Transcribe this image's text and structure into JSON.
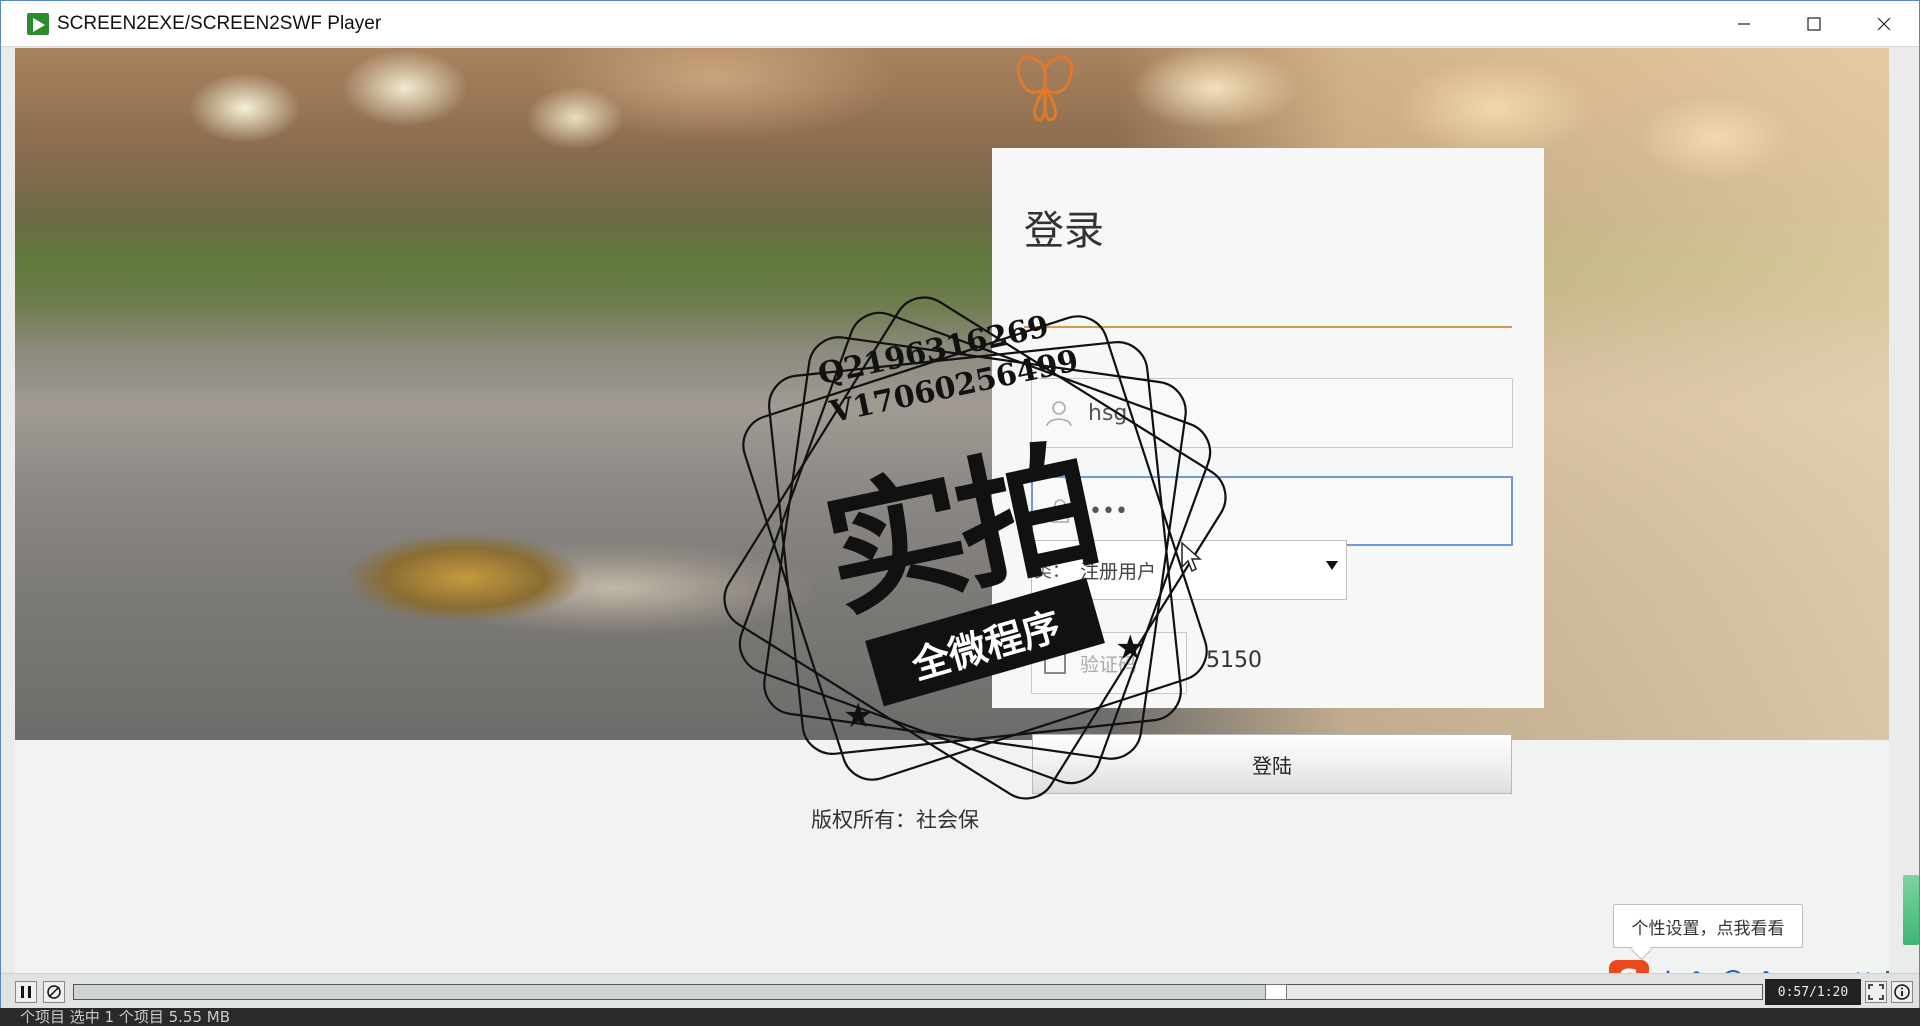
{
  "window": {
    "title": "SCREEN2EXE/SCREEN2SWF Player"
  },
  "login": {
    "title": "登录",
    "username_value": "hsg",
    "password_value": "•••",
    "role_prefix": "类：",
    "role_value": "注册用户",
    "captcha_placeholder": "验证码",
    "captcha_code": "5150",
    "submit_label": "登陆",
    "copyright": "版权所有：社会保"
  },
  "stamp": {
    "line1": "Q2196316269",
    "line2": "V17060256499",
    "big_text": "实拍",
    "ribbon_text": "全微程序"
  },
  "ime": {
    "tooltip": "个性设置，点我看看",
    "logo": "S",
    "lang": "中",
    "punct": "°,"
  },
  "player": {
    "time": "0:57/1:20",
    "progress": 0.712
  },
  "taskbar": {
    "text": "个项目    选中 1 个项目  5.55 MB"
  }
}
